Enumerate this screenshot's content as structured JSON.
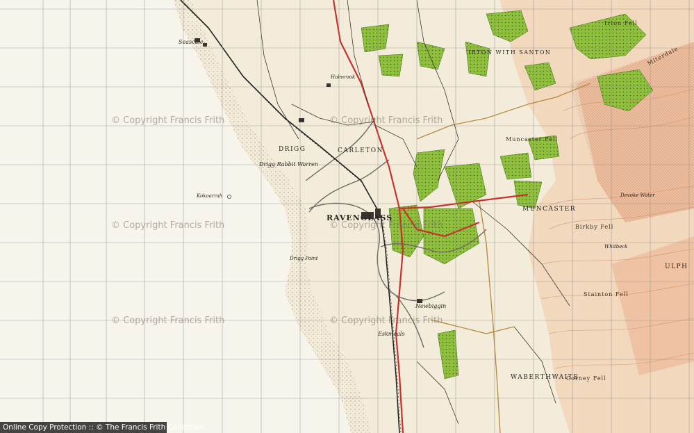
{
  "map": {
    "places": {
      "ravenglass": "RAVENGLASS",
      "drigg": "DRIGG",
      "carleton": "CARLETON",
      "muncaster": "MUNCASTER",
      "waberthwaite": "WABERTHWAITE",
      "muncaster_fell": "Muncaster Fell",
      "drigg_rabbit_warren": "Drigg Rabbit Warren",
      "drigg_point": "Drigg Point",
      "newbiggin": "Newbiggin",
      "eskmeals": "Eskmeals",
      "seascale": "Seascale",
      "holmrook": "Holmrook",
      "irton_santon": "IRTON WITH SANTON",
      "irton_fell": "Irton Fell",
      "birkby_fell": "Birkby Fell",
      "corney_fell": "Corney Fell",
      "stainton_fell": "Stainton Fell",
      "devoke_water": "Devoke Water",
      "kokoarrah": "Kokoarrah",
      "whitbeck": "Whitbeck",
      "ulpha": "ULPH",
      "miterdale": "Miterdale"
    },
    "watermarks": [
      "© Copyright Francis Frith",
      "© Copyright Francis Frith",
      "© Copyright Francis Frith",
      "© Copyright Francis Frith",
      "© Copyright Francis Frith",
      "© Copyright Francis Frith"
    ]
  },
  "footer": {
    "copy_protection": "Online Copy Protection",
    "separator": " :: ",
    "copyright": "© The Francis Frith Collection"
  },
  "colors": {
    "paper": "#f3ecda",
    "woodland": "#8fbf3c",
    "relief": "#e8a27a",
    "road_red": "#c7322c",
    "grid": "#8a8a8a"
  }
}
